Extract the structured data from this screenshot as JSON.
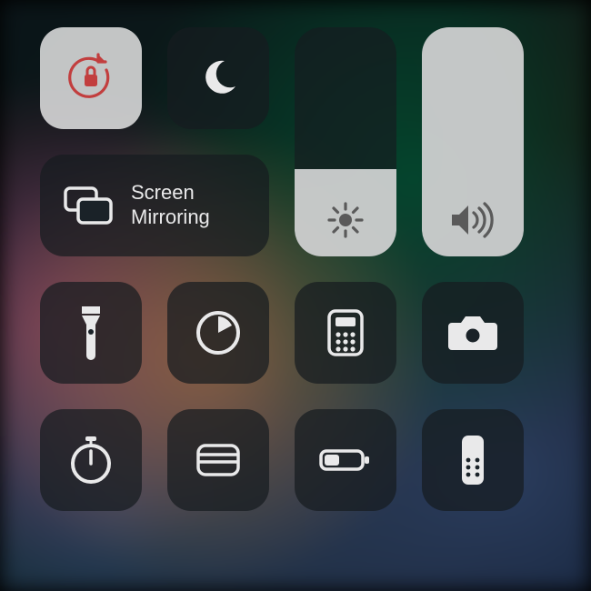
{
  "controls": {
    "orientation_lock": {
      "name": "orientation-lock",
      "active": true
    },
    "do_not_disturb": {
      "name": "do-not-disturb",
      "active": false
    },
    "screen_mirroring": {
      "label_line1": "Screen",
      "label_line2": "Mirroring",
      "name": "screen-mirroring"
    },
    "brightness": {
      "name": "brightness-slider",
      "level_pct": 38
    },
    "volume": {
      "name": "volume-slider",
      "level_pct": 100
    }
  },
  "shortcuts": [
    {
      "name": "flashlight",
      "highlighted": true
    },
    {
      "name": "timer"
    },
    {
      "name": "calculator"
    },
    {
      "name": "camera"
    },
    {
      "name": "stopwatch"
    },
    {
      "name": "wallet"
    },
    {
      "name": "low-power-mode"
    },
    {
      "name": "apple-tv-remote"
    }
  ],
  "colors": {
    "accent_red": "#c23e3e",
    "icon_light": "#e9e9ea",
    "icon_dark": "#4a4a4a"
  }
}
